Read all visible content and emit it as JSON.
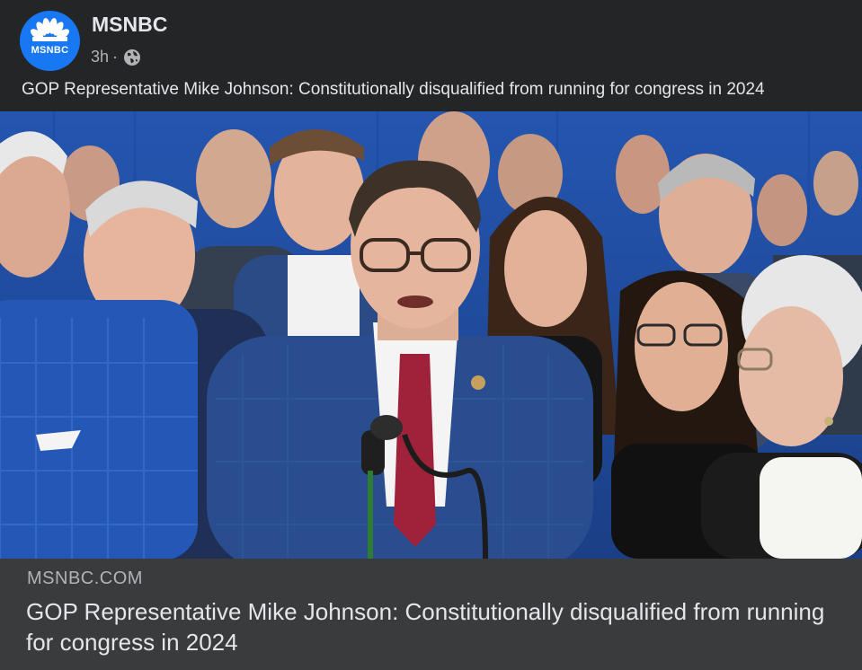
{
  "post": {
    "author": {
      "name": "MSNBC",
      "avatar_text": "MSNBC",
      "avatar_color": "#1877f2"
    },
    "timestamp": "3h",
    "separator": "·",
    "privacy_icon": "globe-icon",
    "text": "GOP Representative Mike Johnson: Constitutionally disqualified from running for congress in 2024"
  },
  "link_preview": {
    "domain": "MSNBC.COM",
    "title": "GOP Representative Mike Johnson: Constitutionally disqualified from running for congress in 2024"
  },
  "photo": {
    "description_icon": "news-photo",
    "backdrop_color": "#2a5eb3"
  },
  "colors": {
    "background": "#242526",
    "preview_background": "#3a3b3c",
    "primary_text": "#e4e6eb",
    "secondary_text": "#b0b3b8"
  }
}
